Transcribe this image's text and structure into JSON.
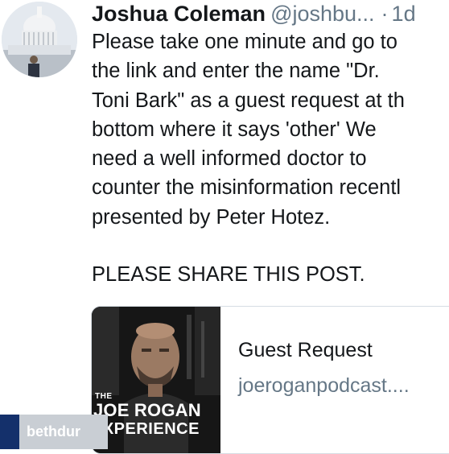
{
  "tweet": {
    "author_name": "Joshua Coleman",
    "handle": "@joshbu...",
    "separator": "·",
    "time": "1d",
    "body_lines": [
      "Please take one minute and go to",
      "the link and enter the name \"Dr.",
      "Toni Bark\" as a guest request at th",
      "bottom where it says 'other' We",
      "need a well informed doctor to",
      "counter the misinformation recentl",
      "presented by Peter Hotez."
    ],
    "share_text": "PLEASE SHARE THIS POST.",
    "card": {
      "title": "Guest Request",
      "domain": "joeroganpodcast....",
      "thumbnail_text": {
        "the": "THE",
        "joe_rogan": "JOE ROGAN",
        "experience": "EXPERIENCE"
      }
    }
  },
  "watermark": {
    "username": "bethdur"
  },
  "icons": {
    "avatar": "capitol-dome-avatar-icon"
  },
  "colors": {
    "text": "#14171a",
    "secondary": "#657786",
    "card_border": "#d6dde3"
  }
}
